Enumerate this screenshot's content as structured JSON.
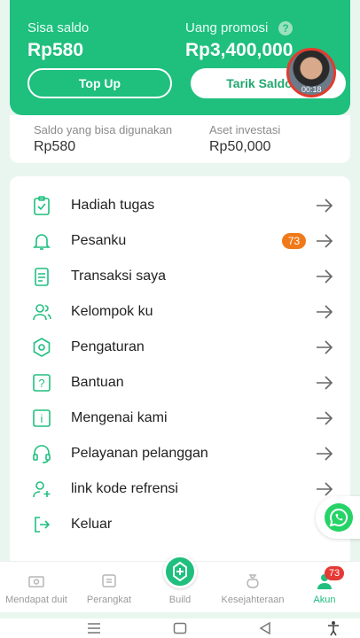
{
  "balance": {
    "saldo_label": "Sisa saldo",
    "saldo_value": "Rp580",
    "promo_label": "Uang promosi",
    "promo_value": "Rp3,400,000",
    "topup_label": "Top Up",
    "tarik_label": "Tarik Saldo"
  },
  "video_overlay": {
    "time": "00:18"
  },
  "sub_balance": {
    "usable_label": "Saldo yang bisa digunakan",
    "usable_value": "Rp580",
    "invest_label": "Aset investasi",
    "invest_value": "Rp50,000"
  },
  "menu": [
    {
      "label": "Hadiah tugas",
      "icon": "clipboard-check-icon"
    },
    {
      "label": "Pesanku",
      "icon": "bell-icon",
      "badge": "73"
    },
    {
      "label": "Transaksi saya",
      "icon": "document-list-icon"
    },
    {
      "label": "Kelompok ku",
      "icon": "group-icon"
    },
    {
      "label": "Pengaturan",
      "icon": "settings-icon"
    },
    {
      "label": "Bantuan",
      "icon": "help-icon"
    },
    {
      "label": "Mengenai kami",
      "icon": "info-icon"
    },
    {
      "label": "Pelayanan pelanggan",
      "icon": "headset-icon"
    },
    {
      "label": "link kode refrensi",
      "icon": "add-user-icon"
    },
    {
      "label": "Keluar",
      "icon": "logout-icon"
    }
  ],
  "bottom_nav": [
    {
      "label": "Mendapat duit",
      "icon": "money-icon"
    },
    {
      "label": "Perangkat",
      "icon": "device-icon"
    },
    {
      "label": "Build",
      "icon": "build-icon"
    },
    {
      "label": "Kesejahteraan",
      "icon": "moneybag-icon"
    },
    {
      "label": "Akun",
      "icon": "account-icon",
      "badge": "73",
      "active": true
    }
  ],
  "colors": {
    "brand": "#1fbf7e",
    "badge_orange": "#f07a1a",
    "badge_red": "#e53935"
  }
}
